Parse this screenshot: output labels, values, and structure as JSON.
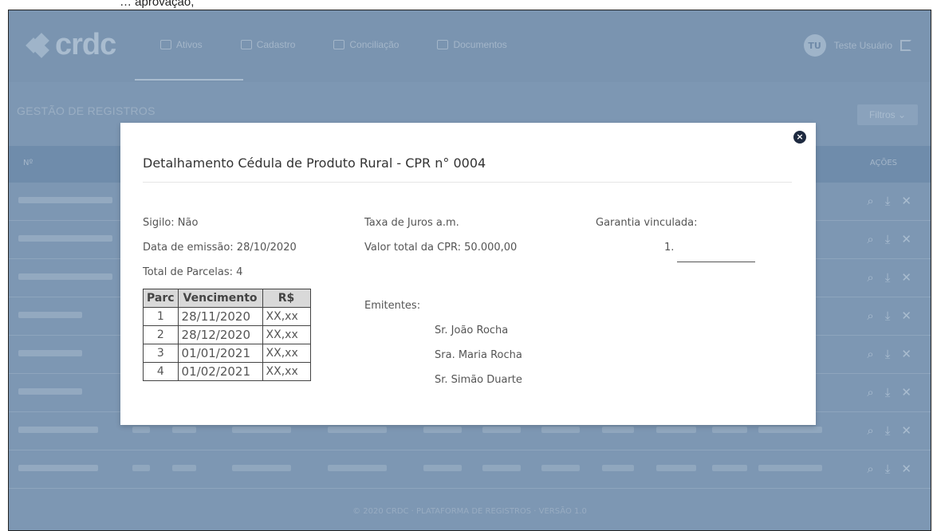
{
  "top_caption": "… aprovação,",
  "app": {
    "logo": "crdc",
    "nav": [
      "Ativos",
      "Cadastro",
      "Conciliação",
      "Documentos"
    ],
    "user_initials": "TU",
    "user_name": "Teste Usuário",
    "page_title": "GESTÃO DE REGISTROS",
    "filter_label": "Filtros",
    "table_header_left": "Nº",
    "table_header_right": "AÇÕES",
    "footer": "© 2020 CRDC · PLATAFORMA DE REGISTROS · VERSÃO 1.0"
  },
  "modal": {
    "title": "Detalhamento Cédula de Produto Rural - CPR n° 0004",
    "sigilo": "Sigilo: Não",
    "data_emissao": "Data de emissão: 28/10/2020",
    "total_parcelas": "Total de Parcelas: 4",
    "taxa_juros": "Taxa de Juros a.m.",
    "valor_total": "Valor total da CPR: 50.000,00",
    "emitentes_label": "Emitentes:",
    "emitentes": [
      "Sr. João Rocha",
      "Sra. Maria Rocha",
      "Sr. Simão Duarte"
    ],
    "garantia_label": "Garantia vinculada:",
    "garantia_item": "1.",
    "parcelas_table": {
      "headers": [
        "Parc",
        "Vencimento",
        "R$"
      ],
      "rows": [
        [
          "1",
          "28/11/2020",
          "XX,xx"
        ],
        [
          "2",
          "28/12/2020",
          "XX,xx"
        ],
        [
          "3",
          "01/01/2021",
          "XX,xx"
        ],
        [
          "4",
          "01/02/2021",
          "XX,xx"
        ]
      ]
    },
    "close_glyph": "×"
  },
  "colors": {
    "overlay_blue": "#7d97b3",
    "close_button": "#1e2a40",
    "table_header_bg": "#d9d9d9"
  }
}
